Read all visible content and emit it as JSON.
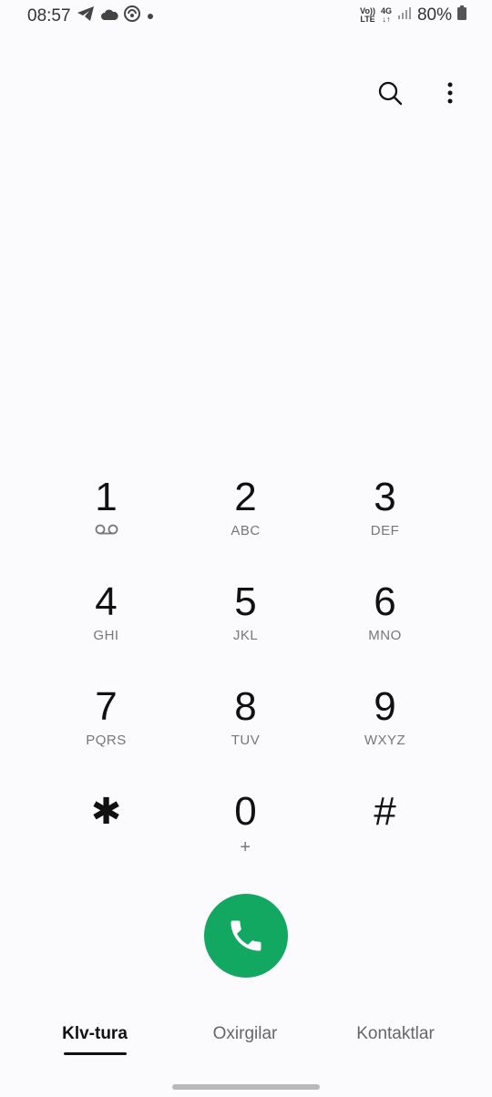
{
  "status_bar": {
    "time": "08:57",
    "left_icons": [
      "telegram-icon",
      "cloud-icon",
      "vpn-icon",
      "notification-dot-icon"
    ],
    "volte_top": "Vo))",
    "volte_bottom": "LTE",
    "network_top": "4G",
    "network_bottom": "↓↑",
    "battery": "80%"
  },
  "actions": {
    "search_icon": "search-icon",
    "more_icon": "more-vertical-icon"
  },
  "keypad": {
    "keys": [
      {
        "digit": "1",
        "letters": ""
      },
      {
        "digit": "2",
        "letters": "ABC"
      },
      {
        "digit": "3",
        "letters": "DEF"
      },
      {
        "digit": "4",
        "letters": "GHI"
      },
      {
        "digit": "5",
        "letters": "JKL"
      },
      {
        "digit": "6",
        "letters": "MNO"
      },
      {
        "digit": "7",
        "letters": "PQRS"
      },
      {
        "digit": "8",
        "letters": "TUV"
      },
      {
        "digit": "9",
        "letters": "WXYZ"
      },
      {
        "digit": "✱",
        "letters": ""
      },
      {
        "digit": "0",
        "letters": "+"
      },
      {
        "digit": "#",
        "letters": ""
      }
    ],
    "key1_sub_icon": "voicemail-icon"
  },
  "call": {
    "icon": "phone-icon",
    "color": "#13a862"
  },
  "tabs": [
    {
      "label": "Klv-tura",
      "active": true
    },
    {
      "label": "Oxirgilar",
      "active": false
    },
    {
      "label": "Kontaktlar",
      "active": false
    }
  ]
}
